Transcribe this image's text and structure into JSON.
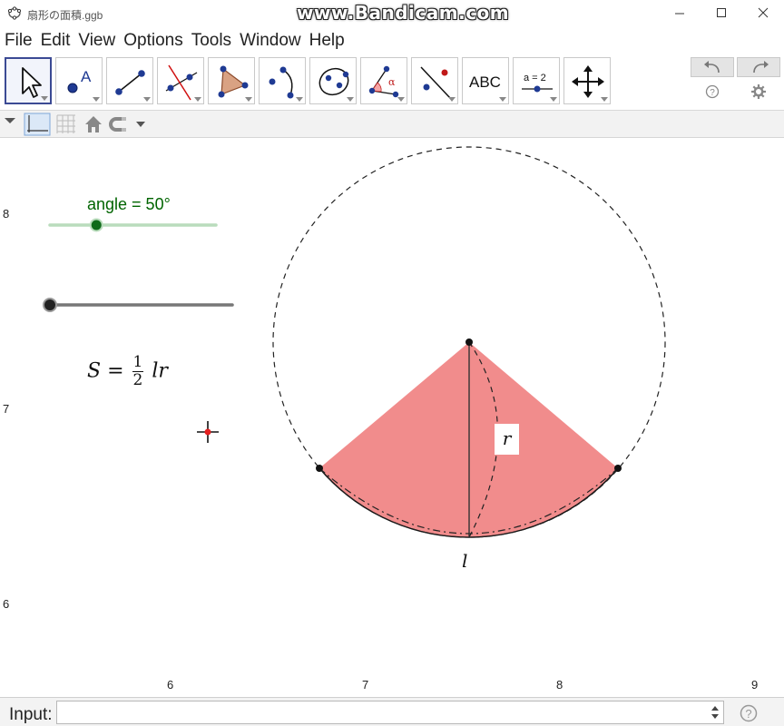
{
  "window": {
    "title": "扇形の面積.ggb",
    "watermark": "www.Bandicam.com",
    "minimize": "minimize",
    "maximize": "maximize",
    "close": "close"
  },
  "menu": [
    "File",
    "Edit",
    "View",
    "Options",
    "Tools",
    "Window",
    "Help"
  ],
  "toolbar": {
    "tools": [
      {
        "name": "move-tool-icon",
        "label": ""
      },
      {
        "name": "point-tool-icon",
        "label": "A"
      },
      {
        "name": "line-tool-icon",
        "label": ""
      },
      {
        "name": "perpendicular-line-tool-icon",
        "label": ""
      },
      {
        "name": "polygon-tool-icon",
        "label": ""
      },
      {
        "name": "arc-tool-icon",
        "label": ""
      },
      {
        "name": "conic-tool-icon",
        "label": ""
      },
      {
        "name": "angle-tool-icon",
        "label": "α"
      },
      {
        "name": "reflect-tool-icon",
        "label": ""
      },
      {
        "name": "text-tool-icon",
        "label": "ABC"
      },
      {
        "name": "slider-tool-icon",
        "label": "a = 2"
      },
      {
        "name": "move-view-tool-icon",
        "label": ""
      }
    ],
    "help_symbol": "?"
  },
  "axis": {
    "y_labels": [
      "8",
      "7",
      "6"
    ],
    "x_labels": [
      "6",
      "7",
      "8",
      "9"
    ]
  },
  "sliders": {
    "angle_label": "angle = 50°",
    "angle_fraction": 0.28,
    "second_fraction": 0.0
  },
  "formula": {
    "lhs": "S =",
    "numerator": "1",
    "denominator": "2",
    "rhs": "lr"
  },
  "labels": {
    "r": "r",
    "l": "l"
  },
  "input": {
    "label": "Input:",
    "value": "",
    "help_symbol": "?"
  },
  "colors": {
    "sector_fill": "#f08080",
    "slider_green": "#006400",
    "selected_tool_border": "#3b4a94"
  }
}
